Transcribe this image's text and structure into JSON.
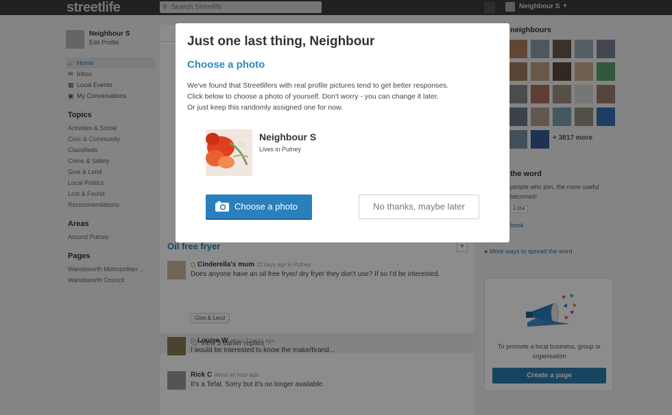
{
  "header": {
    "logo": "streetlife",
    "search_placeholder": "Search Streetlife",
    "user_name": "Neighbour S"
  },
  "sidebar": {
    "profile_name": "Neighbour S",
    "edit_profile": "Edit Profile",
    "nav": [
      {
        "label": "Home",
        "icon": "home-icon"
      },
      {
        "label": "Inbox",
        "icon": "envelope-icon"
      },
      {
        "label": "Local Events",
        "icon": "calendar-icon"
      },
      {
        "label": "My Conversations",
        "icon": "bookmark-icon"
      }
    ],
    "topics_title": "Topics",
    "topics": [
      "Activities & Social",
      "Civic & Community",
      "Classifieds",
      "Crime & Safety",
      "Give & Lend",
      "Local Politics",
      "Lost & Found",
      "Recommendations"
    ],
    "areas_title": "Areas",
    "areas": [
      "Around Putney"
    ],
    "pages_title": "Pages",
    "pages": [
      "Wandsworth Metropolitan ...",
      "Wandsworth Council"
    ]
  },
  "feed": {
    "post_title": "Oil free fryer",
    "first_entry": {
      "author": "Cinderella's mum",
      "meta": "22 days ago in Putney",
      "text": "Does anyone have an oil free fryer/ dry fryer they don't use? If so I'd be interested."
    },
    "tag": "Give & Lend",
    "replies_label": "View 3 earlier replies",
    "replies": [
      {
        "author": "Louise W",
        "meta": "about 3 hours ago",
        "text": "I would be interested to know the make/brand..."
      },
      {
        "author": "Rick C",
        "meta": "about an hour ago",
        "text": "It's a Tefal. Sorry but it's no longer available."
      }
    ]
  },
  "right": {
    "neighbours_title": "neighbours",
    "more_neighbours": "+ 3817 more",
    "spread_title": "the word",
    "spread_text": "people who join, the more useful becomes!",
    "share_count": "4,054",
    "facebook_label": "book",
    "more_ways": "More ways to spread the word",
    "promo_text": "To promote a local business, group or organisation",
    "promo_button": "Create a page"
  },
  "modal": {
    "title": "Just one last thing, Neighbour",
    "subtitle": "Choose a photo",
    "body_lines": [
      "We've found that Streetlifers with real profile pictures tend to get better responses.",
      "Click below to choose a photo of yourself. Don't worry - you can change it later.",
      "Or just keep this randomly assigned one for now."
    ],
    "user_name": "Neighbour S",
    "location": "Lives in Putney",
    "primary_button": "Choose a photo",
    "secondary_button": "No thanks, maybe later"
  },
  "colors": {
    "accent": "#2a7fbd",
    "subtitle": "#2a8bbd",
    "topbar": "#3c3c3c"
  }
}
